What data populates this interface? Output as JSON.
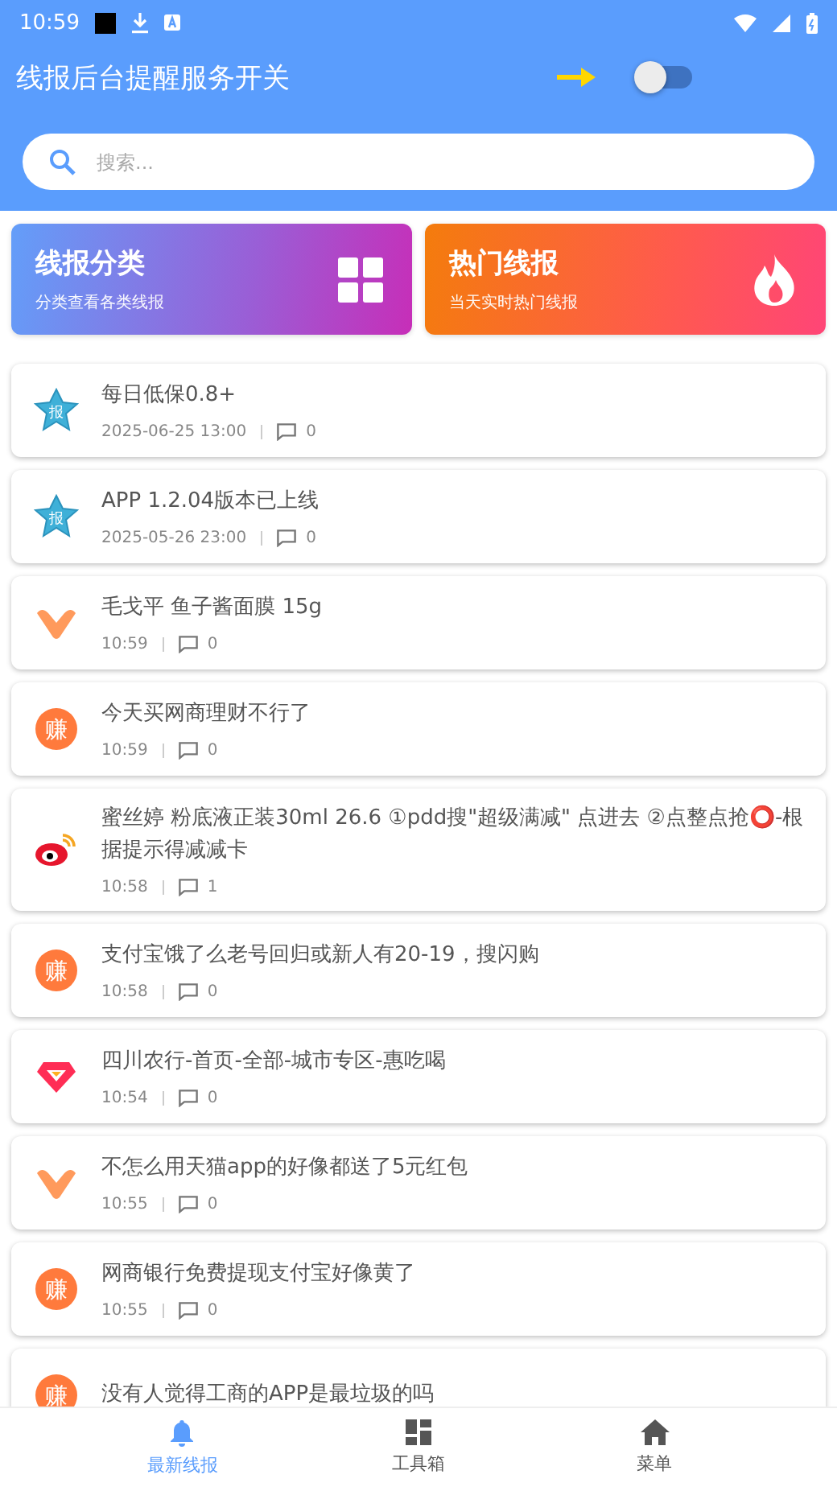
{
  "status_bar": {
    "time": "10:59"
  },
  "header": {
    "title": "线报后台提醒服务开关",
    "switch": {
      "on": false
    },
    "search": {
      "placeholder": "搜索..."
    }
  },
  "categories": [
    {
      "kind": "grid",
      "title": "线报分类",
      "subtitle": "分类查看各类线报"
    },
    {
      "kind": "fire",
      "title": "热门线报",
      "subtitle": "当天实时热门线报"
    }
  ],
  "feed": [
    {
      "kind": "star",
      "icon_label": "报",
      "title": "每日低保0.8+",
      "time": "2025-06-25 13:00",
      "comments": "0"
    },
    {
      "kind": "star",
      "icon_label": "报",
      "title": "APP 1.2.04版本已上线",
      "time": "2025-05-26 23:00",
      "comments": "0"
    },
    {
      "kind": "chevron",
      "title": "毛戈平  鱼子酱面膜 15g",
      "time": "10:59",
      "comments": "0"
    },
    {
      "kind": "coin",
      "icon_label": "赚",
      "title": "今天买网商理财不行了",
      "time": "10:59",
      "comments": "0"
    },
    {
      "kind": "weibo",
      "title": "蜜丝婷 粉底液正装30ml 26.6 ①pdd搜\"超级满减\" 点进去 ②点整点抢⭕-根据提示得减减卡",
      "time": "10:58",
      "comments": "1"
    },
    {
      "kind": "coin",
      "icon_label": "赚",
      "title": "支付宝饿了么老号回归或新人有20-19，搜闪购",
      "time": "10:58",
      "comments": "0"
    },
    {
      "kind": "diamond",
      "title": "四川农行-首页-全部-城市专区-惠吃喝",
      "time": "10:54",
      "comments": "0"
    },
    {
      "kind": "chevron",
      "title": "不怎么用天猫app的好像都送了5元红包",
      "time": "10:55",
      "comments": "0"
    },
    {
      "kind": "coin",
      "icon_label": "赚",
      "title": "网商银行免费提现支付宝好像黄了",
      "time": "10:55",
      "comments": "0"
    },
    {
      "kind": "coin",
      "icon_label": "赚",
      "title": "没有人觉得工商的APP是最垃圾的吗"
    }
  ],
  "bottom_nav": [
    {
      "kind": "bell",
      "label": "最新线报",
      "selected": true
    },
    {
      "kind": "dashboard",
      "label": "工具箱",
      "selected": false
    },
    {
      "kind": "home",
      "label": "菜单",
      "selected": false
    }
  ]
}
